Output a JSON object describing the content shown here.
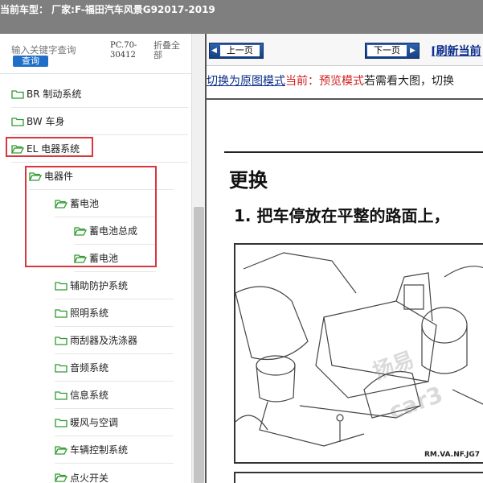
{
  "title": "当前车型： 厂家:F-福田汽车风景G92017-2019",
  "search": {
    "placeholder": "输入关键字查询",
    "query_label": "查询",
    "pc_code": "PC.70-30412",
    "collapse_label": "折叠全部"
  },
  "tree": {
    "items": [
      {
        "label": "BR 制动系统"
      },
      {
        "label": "BW 车身"
      },
      {
        "label": "EL 电器系统"
      },
      {
        "label": "电器件"
      },
      {
        "label": "蓄电池"
      },
      {
        "label": "蓄电池总成"
      },
      {
        "label": "蓄电池"
      },
      {
        "label": "辅助防护系统"
      },
      {
        "label": "照明系统"
      },
      {
        "label": "雨刮器及洗涤器"
      },
      {
        "label": "音频系统"
      },
      {
        "label": "信息系统"
      },
      {
        "label": "暖风与空调"
      },
      {
        "label": "车辆控制系统"
      },
      {
        "label": "点火开关"
      }
    ]
  },
  "nav": {
    "prev_label": "上一页",
    "next_label": "下一页",
    "refresh_label": "[刷新当前"
  },
  "mode": {
    "switch_label": "切换为原图模式",
    "current_label": "当前：预览模式",
    "hint": "若需看大图，切换"
  },
  "doc": {
    "heading": "更换",
    "step": "1. 把车停放在平整的路面上，",
    "figure_caption": "RM.VA.NF.JG7",
    "watermarks": [
      "扬易",
      "car3"
    ]
  },
  "colors": {
    "titlebar": "#7f7f7f",
    "query_button": "#1f6fc8",
    "highlight": "#d9363e",
    "link": "#0b2d8c",
    "current_mode": "#d41f1f",
    "folder": "#2e9a2e"
  }
}
